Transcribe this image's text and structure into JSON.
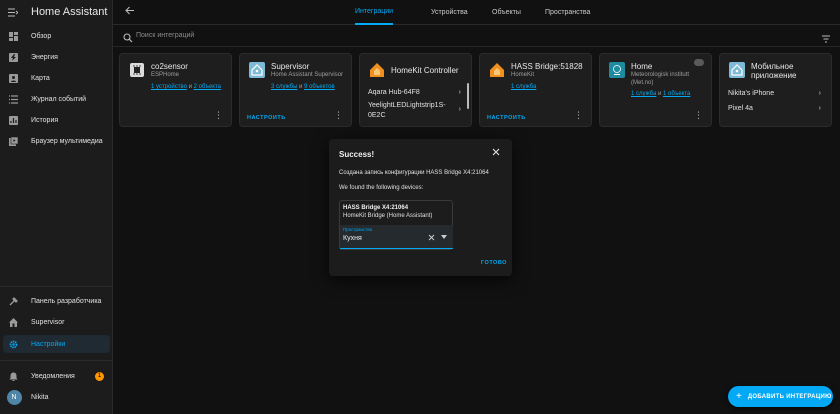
{
  "app": {
    "title": "Home Assistant"
  },
  "sidebar": {
    "items": [
      {
        "label": "Обзор",
        "icon": "dashboard-icon"
      },
      {
        "label": "Энергия",
        "icon": "energy-icon"
      },
      {
        "label": "Карта",
        "icon": "map-icon"
      },
      {
        "label": "Журнал событий",
        "icon": "logbook-icon"
      },
      {
        "label": "История",
        "icon": "history-icon"
      },
      {
        "label": "Браузер мультимедиа",
        "icon": "media-icon"
      }
    ],
    "bottom": [
      {
        "label": "Панель разработчика",
        "icon": "hammer-icon"
      },
      {
        "label": "Supervisor",
        "icon": "home-icon"
      },
      {
        "label": "Настройки",
        "icon": "gear-icon",
        "active": true
      }
    ],
    "notifications": {
      "label": "Уведомления",
      "count": "1"
    },
    "user": {
      "name": "Nikita",
      "initial": "N"
    }
  },
  "tabs": [
    {
      "label": "Интеграции",
      "active": true
    },
    {
      "label": "Устройства"
    },
    {
      "label": "Объекты"
    },
    {
      "label": "Пространства"
    }
  ],
  "search": {
    "placeholder": "Поиск интеграций"
  },
  "cards": [
    {
      "name": "co2sensor",
      "sub": "ESPHome",
      "link1": "1 устройство",
      "and": " и ",
      "link2": "2 объекта"
    },
    {
      "name": "Supervisor",
      "sub": "Home Assistant Supervisor",
      "link1": "3 службы",
      "and": " и ",
      "link2": "9 объектов",
      "action": "НАСТРОИТЬ"
    },
    {
      "name": "HomeKit Controller",
      "rows": [
        "Aqara Hub-64F8",
        "YeelightLEDLightstrip1S-",
        "0E2C"
      ]
    },
    {
      "name": "HASS Bridge:51828",
      "sub": "HomeKit",
      "link1": "1 служба",
      "action": "НАСТРОИТЬ"
    },
    {
      "name": "Home",
      "sub1": "Meteorologisk institutt",
      "sub2": "(Met.no)",
      "link1": "1 служба",
      "and": " и ",
      "link2": "1 объекта"
    },
    {
      "name1": "Мобильное",
      "name2": "приложение",
      "rows": [
        "Nikita's iPhone",
        "Pixel 4a"
      ]
    }
  ],
  "dialog": {
    "title": "Success!",
    "created": "Создана запись конфигурации HASS Bridge X4:21064",
    "found": "We found the following devices:",
    "device_name": "HASS Bridge X4:21064",
    "device_model": "HomeKit Bridge (Home Assistant)",
    "area_label": "Пространство",
    "area_value": "Кухня",
    "done": "ГОТОВО"
  },
  "fab": {
    "label": "ДОБАВИТЬ ИНТЕГРАЦИЮ"
  },
  "colors": {
    "accent": "#03a9f4",
    "homekit_orange": "#f0901e",
    "met_teal": "#1e8ca0",
    "badge": "#ff9800"
  }
}
